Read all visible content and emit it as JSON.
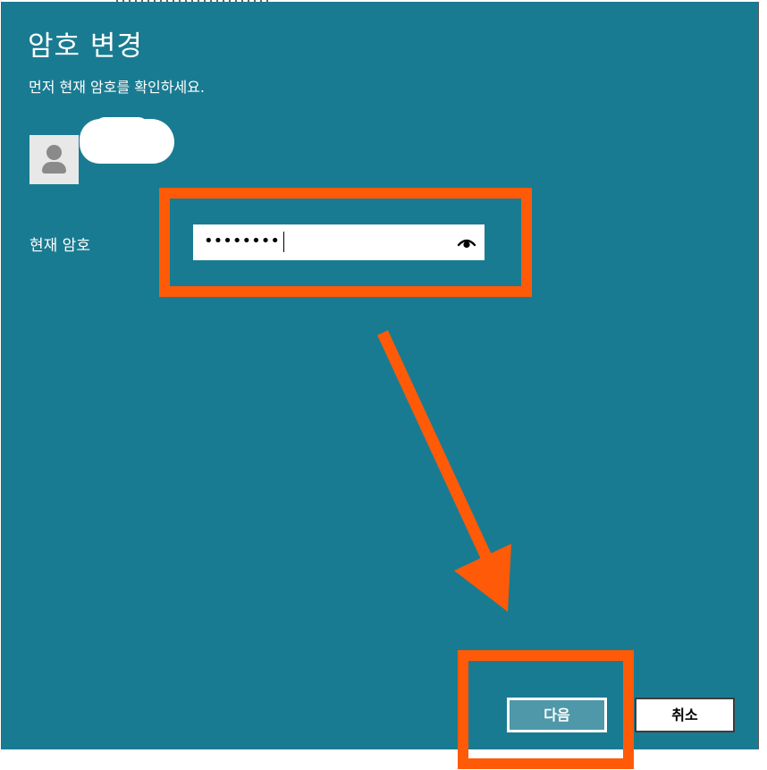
{
  "dialog": {
    "title": "암호 변경",
    "subtitle": "먼저 현재 암호를 확인하세요.",
    "avatar_icon": "user-avatar-icon",
    "colors": {
      "background": "#197b91",
      "annotation": "#ff5a08",
      "primary_button": "#4e98a9"
    }
  },
  "password_field": {
    "label": "현재 암호",
    "masked_value": "••••••••",
    "reveal_icon": "eye-icon"
  },
  "buttons": {
    "next_label": "다음",
    "cancel_label": "취소"
  }
}
